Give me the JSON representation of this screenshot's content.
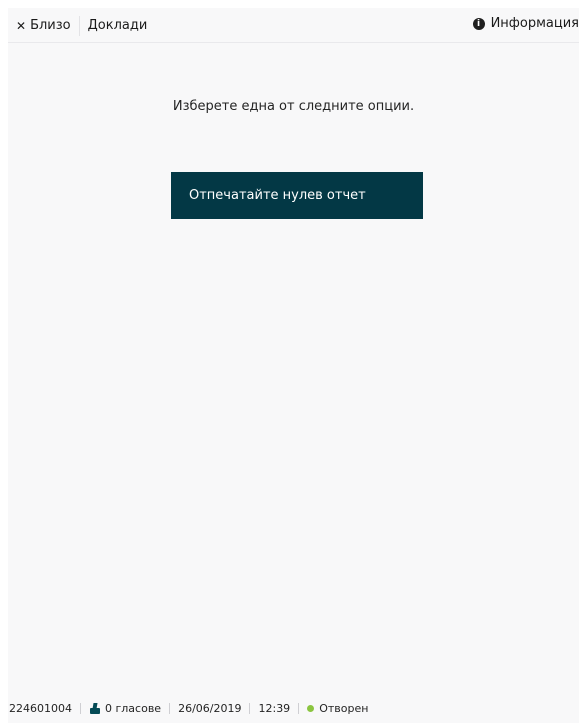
{
  "topbar": {
    "close_label": "Близо",
    "reports_label": "Доклади",
    "info_label": "Информация"
  },
  "main": {
    "instruction": "Изберете една от следните опции.",
    "print_zero_report_label": "Отпечатайте нулев отчет"
  },
  "status": {
    "terminal_id": "224601004",
    "votes": "0 гласове",
    "date": "26/06/2019",
    "time": "12:39",
    "state": "Отворен",
    "state_color": "#8bc540"
  },
  "icons": {
    "close": "close-icon",
    "info": "info-icon",
    "ballot": "ballot-box-icon",
    "status": "status-dot-icon"
  }
}
